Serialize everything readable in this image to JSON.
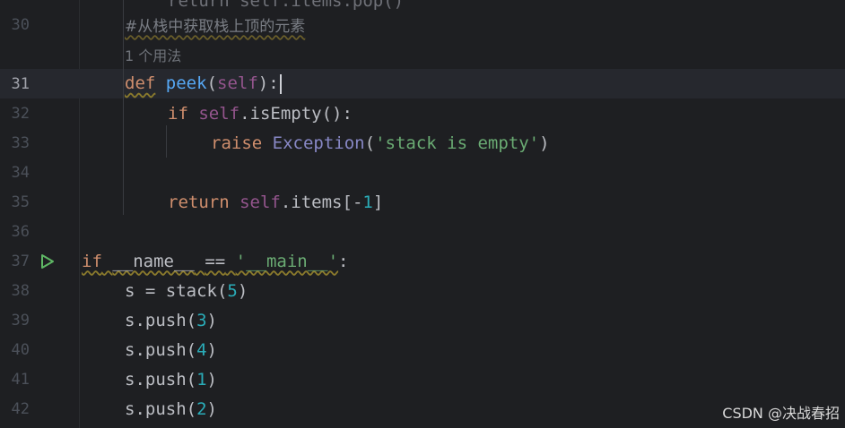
{
  "editor": {
    "lines": [
      {
        "num": "30",
        "text": "#从栈中获取栈上顶的元素"
      },
      {
        "num": "",
        "hint": "1 个用法"
      },
      {
        "num": "31"
      },
      {
        "num": "32"
      },
      {
        "num": "33"
      },
      {
        "num": "34"
      },
      {
        "num": "35"
      },
      {
        "num": "36"
      },
      {
        "num": "37"
      },
      {
        "num": "38"
      },
      {
        "num": "39"
      },
      {
        "num": "40"
      },
      {
        "num": "41"
      },
      {
        "num": "42"
      }
    ],
    "top_partial": "return self.items.pop()",
    "tokens": {
      "def": "def",
      "peek": "peek",
      "lparen": "(",
      "self": "self",
      "rparen_colon": "):",
      "if": "if",
      "self_dot": "self",
      "is_empty": ".isEmpty():",
      "raise": "raise",
      "exception": "Exception",
      "paren_open": "(",
      "stack_empty": "'stack is empty'",
      "paren_close": ")",
      "return": "return",
      "self_ret": "self",
      "items": ".items[",
      "minus": "-",
      "one": "1",
      "close_bracket": "]",
      "if_main": "if",
      "dunder_name": "__name__",
      "eqeq": "==",
      "main_str": "'__main__'",
      "colon": ":",
      "s_assign": "s = stack(",
      "five": "5",
      "close1": ")",
      "push": "s.push(",
      "v3": "3",
      "v4": "4",
      "v1": "1",
      "v2": "2",
      "close_paren": ")"
    }
  },
  "watermark": "CSDN @决战春招",
  "colors": {
    "background": "#1e1f22",
    "keyword": "#cf8e6d",
    "function": "#56a8f5",
    "self": "#94558d",
    "number": "#2aacb8",
    "string": "#6aab73"
  }
}
